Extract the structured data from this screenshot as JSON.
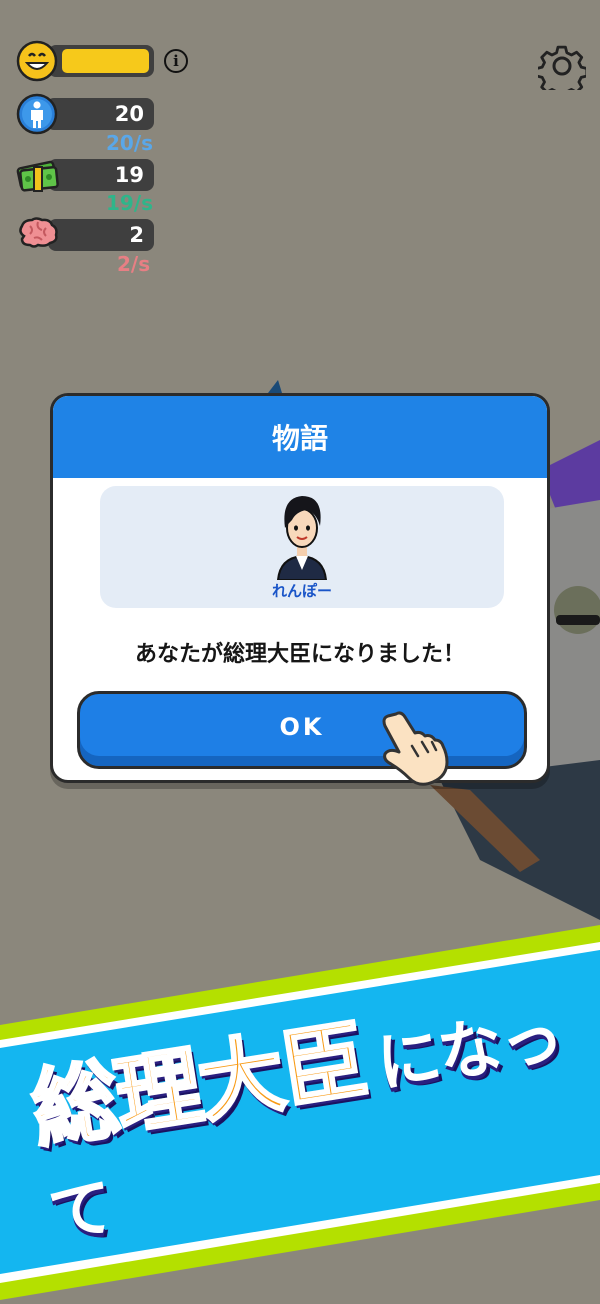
{
  "hud": {
    "mood_bar_fill": 1.0,
    "population": {
      "value": "20",
      "rate": "20/s",
      "color": "#5aa7e8"
    },
    "money": {
      "value": "19",
      "rate": "19/s",
      "color": "#2fb58a"
    },
    "brain": {
      "value": "2",
      "rate": "2/s",
      "color": "#e77f84"
    }
  },
  "dialog": {
    "title": "物語",
    "character_name": "れんぽー",
    "message": "あなたが総理大臣になりました！",
    "ok_label": "OK"
  },
  "banner": {
    "headline": "総理大臣",
    "suffix": "になって"
  },
  "colors": {
    "dialog_header": "#1f83e6",
    "banner_cyan": "#14b6f0",
    "banner_lime": "#b4e000",
    "headline_orange": "#f89a14"
  }
}
